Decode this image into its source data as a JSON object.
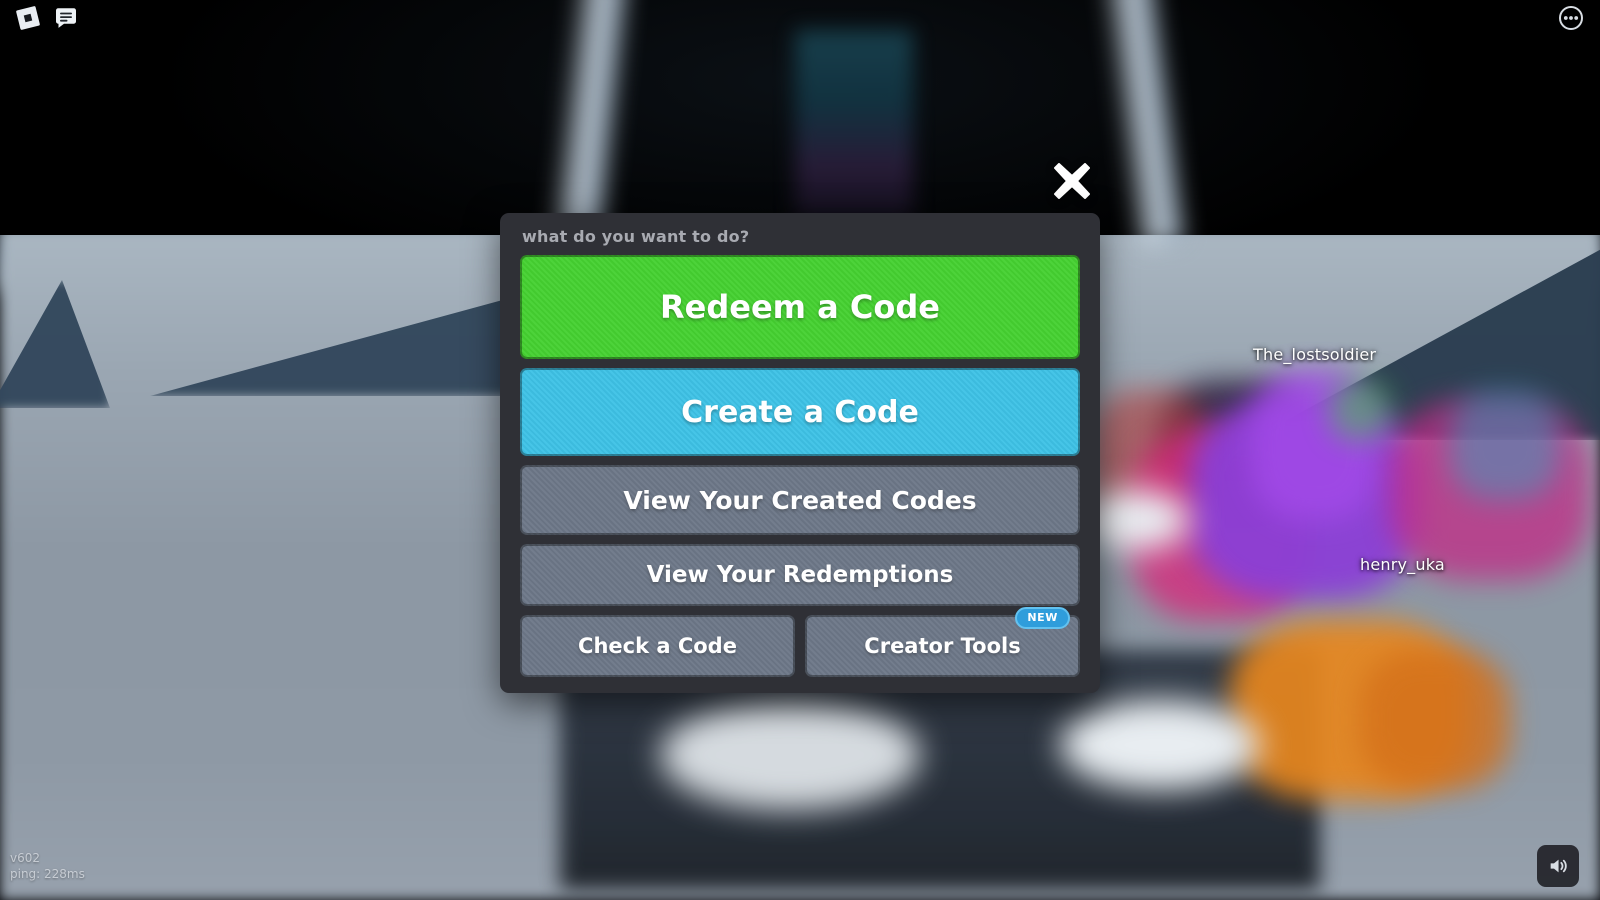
{
  "game": {
    "topbar": {
      "roblox_logo_icon": "roblox-logo-icon",
      "chat_icon": "chat-icon",
      "more_icon": "more-options-icon"
    },
    "diagnostics": {
      "version": "v602",
      "ping": "ping: 228ms"
    },
    "volume_icon": "volume-on-icon",
    "nametags": [
      {
        "name": "The_lostsoldier"
      },
      {
        "name": "henry_uka"
      }
    ]
  },
  "modal": {
    "close_icon": "close-x-icon",
    "title": "what do you want to do?",
    "buttons": [
      {
        "label": "Redeem a Code",
        "style": "green",
        "color": "#45d131"
      },
      {
        "label": "Create a Code",
        "style": "blue",
        "color": "#3ec2e6"
      },
      {
        "label": "View Your Created Codes",
        "style": "gray",
        "color": "#6d7788"
      },
      {
        "label": "View Your Redemptions",
        "style": "gray",
        "color": "#6d7788"
      }
    ],
    "bottom_row": [
      {
        "label": "Check a Code",
        "badge": ""
      },
      {
        "label": "Creator Tools",
        "badge": "NEW"
      }
    ],
    "badge_color": "#2f9ddb",
    "panel_color": "#2f3036",
    "title_color": "#a8aab1"
  }
}
